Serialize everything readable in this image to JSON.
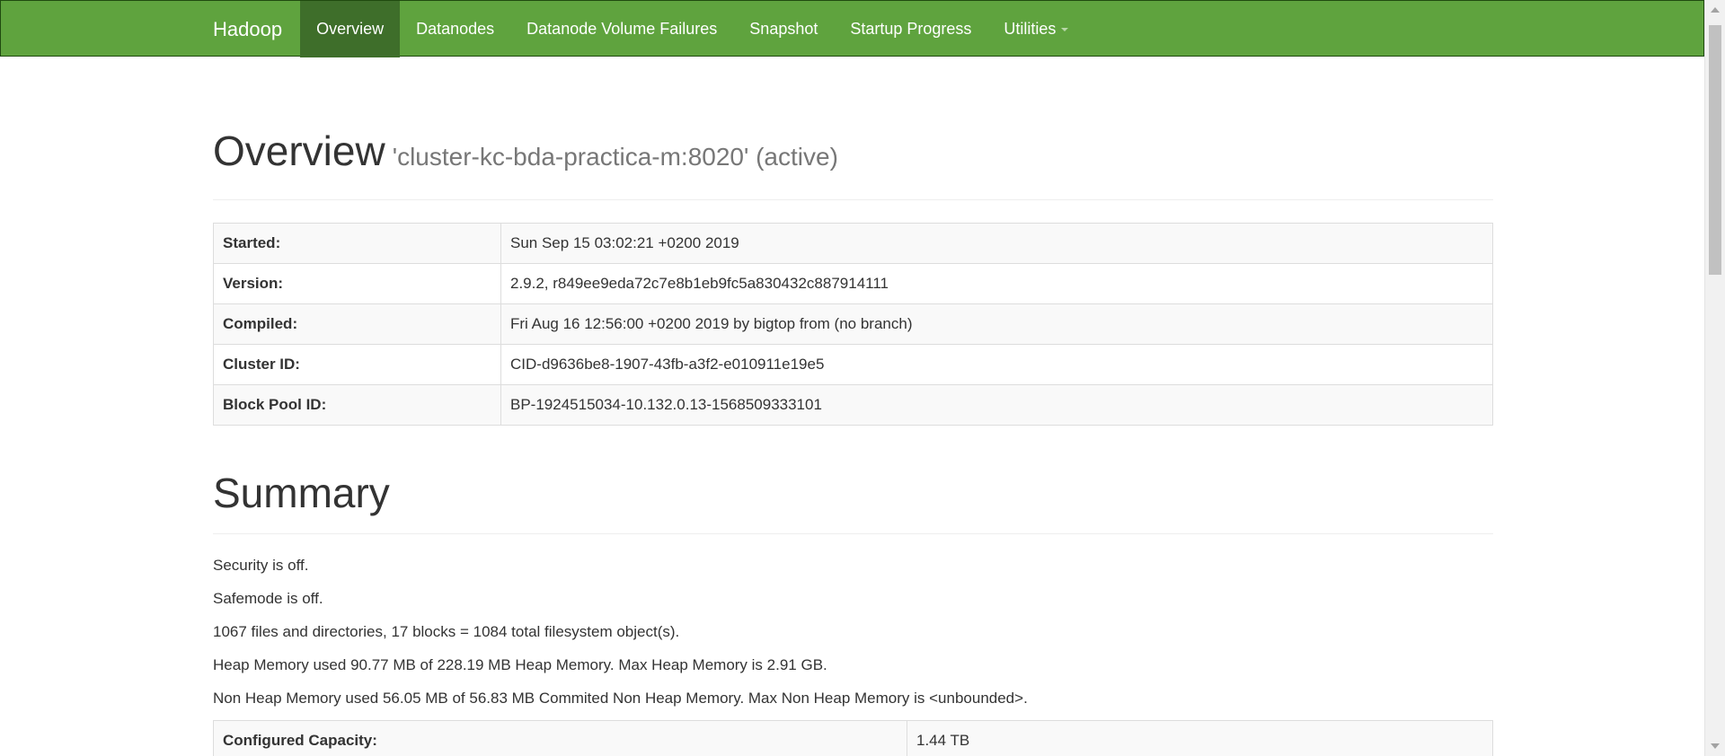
{
  "navbar": {
    "brand": "Hadoop",
    "items": [
      {
        "label": "Overview",
        "active": true
      },
      {
        "label": "Datanodes"
      },
      {
        "label": "Datanode Volume Failures"
      },
      {
        "label": "Snapshot"
      },
      {
        "label": "Startup Progress"
      },
      {
        "label": "Utilities",
        "dropdown": true
      }
    ]
  },
  "overview": {
    "title": "Overview",
    "subtitle": "'cluster-kc-bda-practica-m:8020' (active)",
    "rows": [
      {
        "label": "Started:",
        "value": "Sun Sep 15 03:02:21 +0200 2019"
      },
      {
        "label": "Version:",
        "value": "2.9.2, r849ee9eda72c7e8b1eb9fc5a830432c887914111"
      },
      {
        "label": "Compiled:",
        "value": "Fri Aug 16 12:56:00 +0200 2019 by bigtop from (no branch)"
      },
      {
        "label": "Cluster ID:",
        "value": "CID-d9636be8-1907-43fb-a3f2-e010911e19e5"
      },
      {
        "label": "Block Pool ID:",
        "value": "BP-1924515034-10.132.0.13-1568509333101"
      }
    ]
  },
  "summary": {
    "title": "Summary",
    "lines": [
      "Security is off.",
      "Safemode is off.",
      "1067 files and directories, 17 blocks = 1084 total filesystem object(s).",
      "Heap Memory used 90.77 MB of 228.19 MB Heap Memory. Max Heap Memory is 2.91 GB.",
      "Non Heap Memory used 56.05 MB of 56.83 MB Commited Non Heap Memory. Max Non Heap Memory is <unbounded>."
    ],
    "capacity": {
      "label": "Configured Capacity:",
      "value": "1.44 TB"
    }
  },
  "colors": {
    "navbar_bg": "#5fa33e",
    "navbar_active": "#3e6e2a"
  }
}
